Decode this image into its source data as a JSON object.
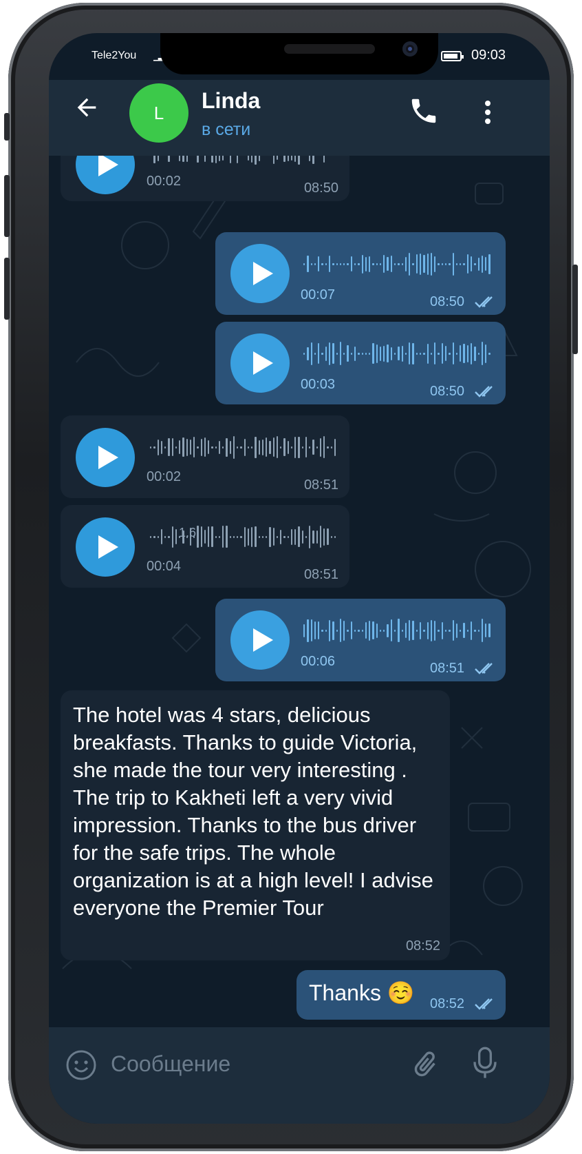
{
  "status": {
    "carrier": "Tele2You",
    "time": "09:03"
  },
  "chat_header": {
    "avatar_letter": "L",
    "name": "Linda",
    "status": "в сети"
  },
  "messages": [
    {
      "dir": "in",
      "type": "voice",
      "duration": "00:02",
      "time": "08:50"
    },
    {
      "dir": "out",
      "type": "voice",
      "duration": "00:07",
      "time": "08:50"
    },
    {
      "dir": "out",
      "type": "voice",
      "duration": "00:03",
      "time": "08:50"
    },
    {
      "dir": "in",
      "type": "voice",
      "duration": "00:02",
      "time": "08:51"
    },
    {
      "dir": "in",
      "type": "voice",
      "duration": "00:04",
      "time": "08:51",
      "wave_label": "1.6"
    },
    {
      "dir": "out",
      "type": "voice",
      "duration": "00:06",
      "time": "08:51"
    },
    {
      "dir": "in",
      "type": "text",
      "text": "The hotel was 4 stars, delicious breakfasts. Thanks to guide Victoria, she made the tour very interesting . The trip to Kakheti left a very vivid impression. Thanks to the bus driver for the safe trips. The whole organization is at a high level! I advise everyone the Premier Tour",
      "time": "08:52"
    },
    {
      "dir": "out",
      "type": "text",
      "text": "Thanks ☺️",
      "time": "08:52"
    }
  ],
  "composer": {
    "placeholder": "Сообщение"
  },
  "icons": [
    "back-arrow-icon",
    "phone-icon",
    "more-vert-icon",
    "play-icon",
    "double-check-icon",
    "emoji-icon",
    "attach-icon",
    "mic-icon"
  ],
  "colors": {
    "chat_bg": "#0f1c29",
    "header_bg": "#1d2d3c",
    "incoming": "#182533",
    "outgoing": "#2b5278",
    "accent": "#2f9adb",
    "online": "#5aa9e6",
    "avatar": "#3cc94a"
  }
}
